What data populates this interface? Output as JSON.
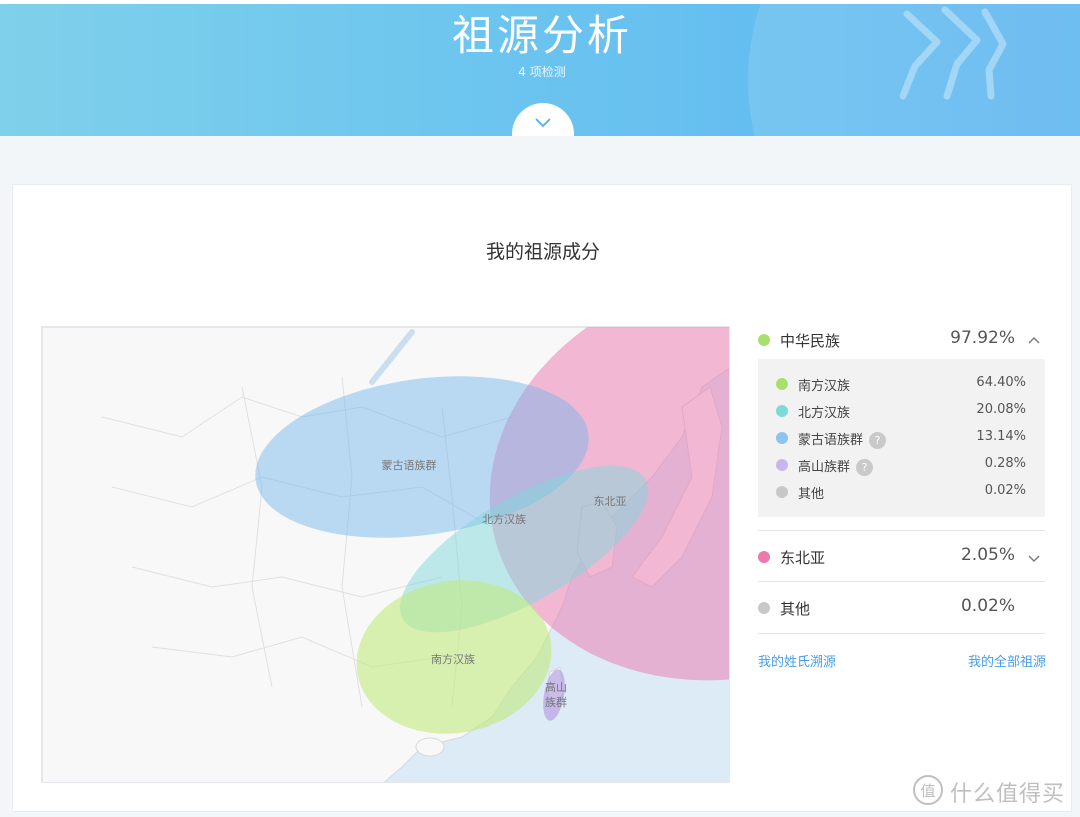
{
  "header": {
    "title": "祖源分析",
    "subtitle": "4 项检测"
  },
  "card": {
    "title": "我的祖源成分"
  },
  "map": {
    "regions": [
      {
        "label": "蒙古语族群",
        "color": "#8ec6f0"
      },
      {
        "label": "北方汉族",
        "color": "#8fdfe2"
      },
      {
        "label": "东北亚",
        "color": "#ee8ec0"
      },
      {
        "label": "南方汉族",
        "color": "#c7eb8e"
      },
      {
        "label": "高山\n族群",
        "label_line1": "高山",
        "label_line2": "族群",
        "color": "#c9b0e6"
      }
    ]
  },
  "legend": {
    "groups": [
      {
        "label": "中华民族",
        "percent": "97.92%",
        "color": "#a8e06e",
        "expanded": true,
        "chevron": "chevron-up-icon",
        "children": [
          {
            "label": "南方汉族",
            "percent": "64.40%",
            "color": "#a8e06e"
          },
          {
            "label": "北方汉族",
            "percent": "20.08%",
            "color": "#7ed9d9"
          },
          {
            "label": "蒙古语族群",
            "percent": "13.14%",
            "color": "#8cc4ef",
            "help": "?"
          },
          {
            "label": "高山族群",
            "percent": "0.28%",
            "color": "#c7b7ec",
            "help": "?"
          },
          {
            "label": "其他",
            "percent": "0.02%",
            "color": "#c8c8c8"
          }
        ]
      },
      {
        "label": "东北亚",
        "percent": "2.05%",
        "color": "#ec78ad",
        "expanded": false,
        "chevron": "chevron-down-icon"
      },
      {
        "label": "其他",
        "percent": "0.02%",
        "color": "#c8c8c8",
        "expanded": false
      }
    ]
  },
  "links": {
    "surname": "我的姓氏溯源",
    "all_ancestry": "我的全部祖源"
  },
  "watermark": {
    "text": "什么值得买",
    "logo_char": "值"
  }
}
